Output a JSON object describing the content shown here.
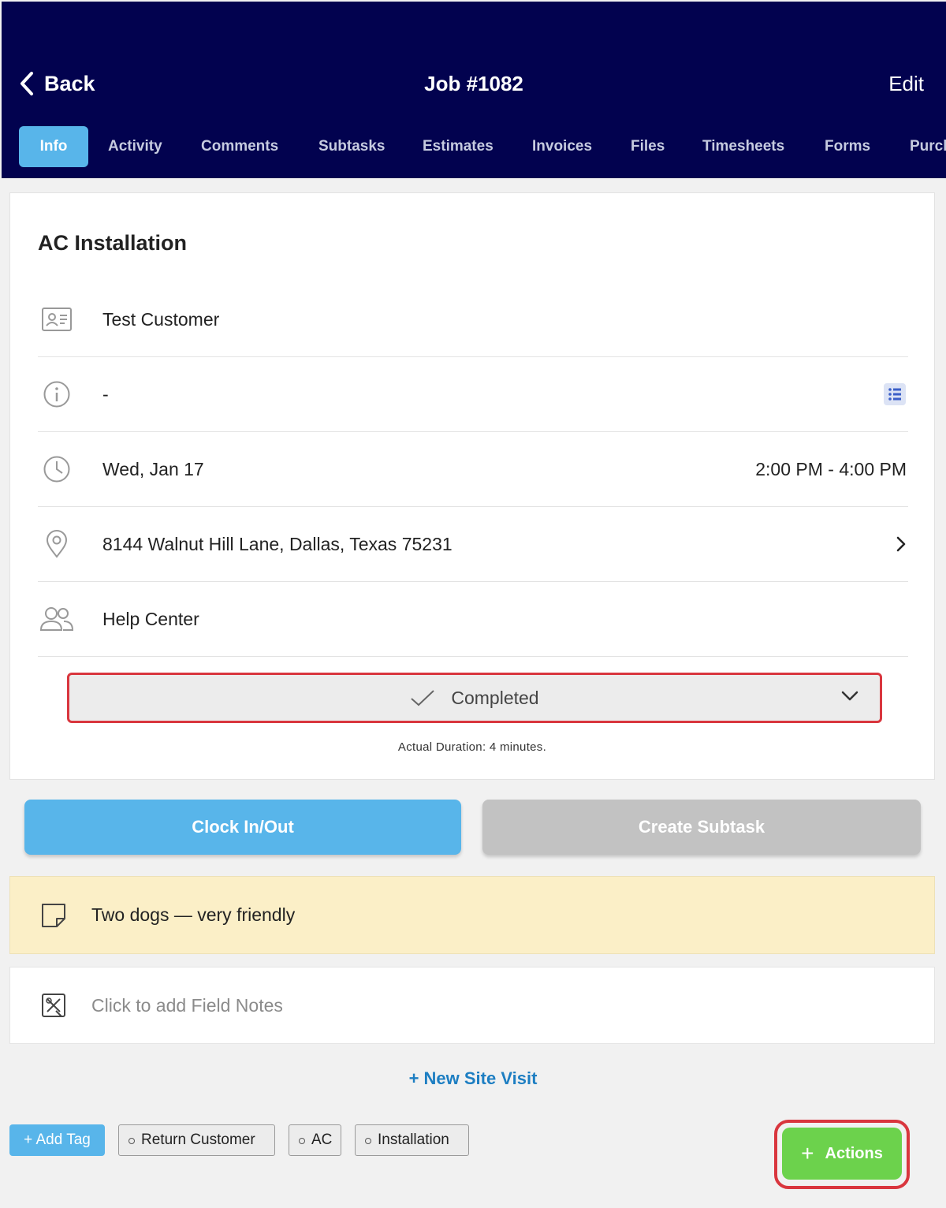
{
  "header": {
    "back_label": "Back",
    "title": "Job #1082",
    "edit_label": "Edit",
    "tabs": [
      {
        "label": "Info",
        "active": true
      },
      {
        "label": "Activity",
        "active": false
      },
      {
        "label": "Comments",
        "active": false
      },
      {
        "label": "Subtasks",
        "active": false
      },
      {
        "label": "Estimates",
        "active": false
      },
      {
        "label": "Invoices",
        "active": false
      },
      {
        "label": "Files",
        "active": false
      },
      {
        "label": "Timesheets",
        "active": false
      },
      {
        "label": "Forms",
        "active": false
      },
      {
        "label": "Purch",
        "active": false
      }
    ]
  },
  "job": {
    "title": "AC Installation",
    "customer": "Test Customer",
    "info": "-",
    "date": "Wed, Jan 17",
    "time_range": "2:00 PM - 4:00 PM",
    "address": "8144 Walnut Hill Lane, Dallas, Texas 75231",
    "team": "Help Center",
    "status": "Completed",
    "duration": "Actual Duration: 4 minutes."
  },
  "buttons": {
    "clock": "Clock In/Out",
    "create_subtask": "Create Subtask"
  },
  "note": {
    "text": "Two dogs — very friendly"
  },
  "field_notes": {
    "placeholder": "Click to add Field Notes"
  },
  "new_site_visit": "+ New Site Visit",
  "tags": {
    "add_label": "+ Add Tag",
    "items": [
      "Return Customer",
      "AC",
      "Installation"
    ]
  },
  "actions_label": "Actions",
  "icons": {
    "back": "chevron-left-icon",
    "customer": "contact-card-icon",
    "info": "info-icon",
    "time": "clock-icon",
    "location": "map-pin-icon",
    "team": "users-icon",
    "status": "checkmark-icon",
    "note": "sticky-note-icon",
    "field_notes": "field-notes-icon"
  },
  "colors": {
    "header_bg": "#02024f",
    "active_tab": "#58b5ea",
    "clock_button": "#58b5ea",
    "subtask_button": "#c2c2c2",
    "note_bg": "#fbefc7",
    "actions_button": "#6cd24c",
    "highlight": "#d9363e",
    "link": "#1d7ec2"
  }
}
